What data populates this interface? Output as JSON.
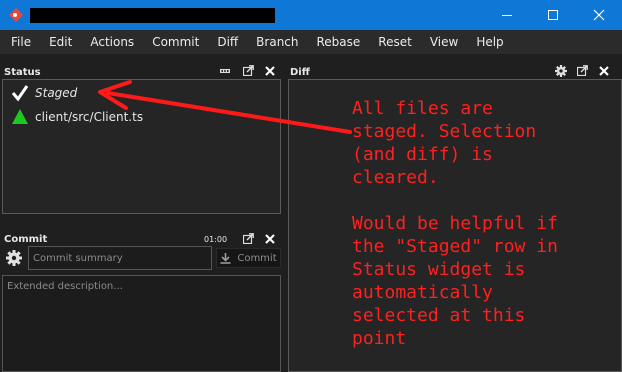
{
  "window": {
    "title_redacted": true,
    "accent_color": "#0f78d7",
    "icons": [
      "app-diamond-icon",
      "minimize-icon",
      "maximize-icon",
      "close-icon"
    ]
  },
  "menu": [
    "File",
    "Edit",
    "Actions",
    "Commit",
    "Diff",
    "Branch",
    "Rebase",
    "Reset",
    "View",
    "Help"
  ],
  "status_panel": {
    "title": "Status",
    "rows": [
      {
        "label": "Staged",
        "icon": "checkmark-icon"
      },
      {
        "label": "client/src/Client.ts",
        "icon": "added-triangle-icon",
        "icon_color": "#1ec81e"
      }
    ]
  },
  "diff_panel": {
    "title": "Diff"
  },
  "commit_panel": {
    "title": "Commit",
    "time": "01:00",
    "summary_placeholder": "Commit summary",
    "description_placeholder": "Extended description...",
    "commit_button": "Commit"
  },
  "annotation": {
    "color": "#ff2020",
    "lines": [
      "All files are",
      "staged. Selection",
      "(and diff) is",
      "cleared.",
      "",
      "Would be helpful if",
      "the \"Staged\" row in",
      "Status widget is",
      "automatically",
      "selected at this",
      "point"
    ]
  }
}
